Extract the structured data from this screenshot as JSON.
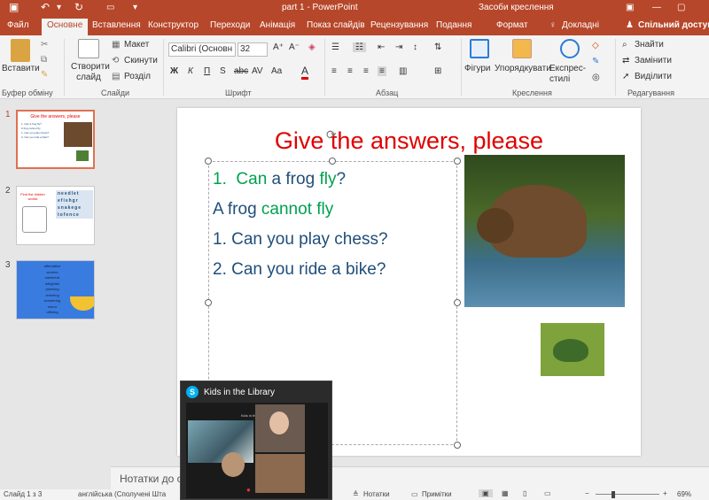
{
  "titlebar": {
    "title": "part 1 - PowerPoint",
    "contextual": "Засоби креслення"
  },
  "tabs": [
    {
      "label": "Файл"
    },
    {
      "label": "Основне"
    },
    {
      "label": "Вставлення"
    },
    {
      "label": "Конструктор"
    },
    {
      "label": "Переходи"
    },
    {
      "label": "Анімація"
    },
    {
      "label": "Показ слайдів"
    },
    {
      "label": "Рецензування"
    },
    {
      "label": "Подання"
    },
    {
      "label": "Формат"
    }
  ],
  "tab_search": "Докладні",
  "share_label": "Спільний доступ",
  "ribbon": {
    "paste": "Вставити",
    "new_slide": "Створити слайд",
    "layout": "Макет",
    "reset": "Скинути",
    "section": "Розділ",
    "font_name": "Calibri (Основн",
    "font_size": "32",
    "shapes": "Фігури",
    "arrange": "Упорядкувати",
    "quick_styles": "Експрес-стилі",
    "find": "Знайти",
    "replace": "Замінити",
    "select": "Виділити",
    "groups": {
      "clipboard": "Буфер обміну",
      "slides": "Слайди",
      "font": "Шрифт",
      "paragraph": "Абзац",
      "drawing": "Креслення",
      "editing": "Редагування"
    }
  },
  "thumbnails": [
    {
      "num": "1",
      "title": "Give the answers, please"
    },
    {
      "num": "2",
      "title": "Find the hidden words",
      "grid": [
        "needlet",
        "efishgr",
        "snakege",
        "tofence"
      ]
    },
    {
      "num": "3",
      "words": [
        "alternative",
        "worries",
        "weekend",
        "delightful",
        "planning",
        "cheering",
        "wondering",
        "mirror",
        "offering"
      ]
    }
  ],
  "slide": {
    "title": "Give the answers, please",
    "q1_num": "1.",
    "q1_can": "Can",
    "q1_mid": " a frog ",
    "q1_fly": "fly",
    "q1_q": "?",
    "a_frog": "A frog ",
    "a_cannot": "cannot fly",
    ".": ".",
    "q2": "1.  Can you play chess?",
    "q3": "2.  Can you ride a bike?"
  },
  "notes": "Нотатки до с",
  "popup": {
    "title": "Kids in the Library",
    "inner_title": "Kids in the Library"
  },
  "status": {
    "slide": "Слайд 1 з 3",
    "lang": "англійська (Сполучені Шта",
    "notes": "Нотатки",
    "comments": "Примітки",
    "zoom": "69%"
  },
  "colors": {
    "accent": "#b7472a",
    "slide_title": "#e00000",
    "blue_text": "#1f4e79",
    "green_text": "#00a050"
  }
}
